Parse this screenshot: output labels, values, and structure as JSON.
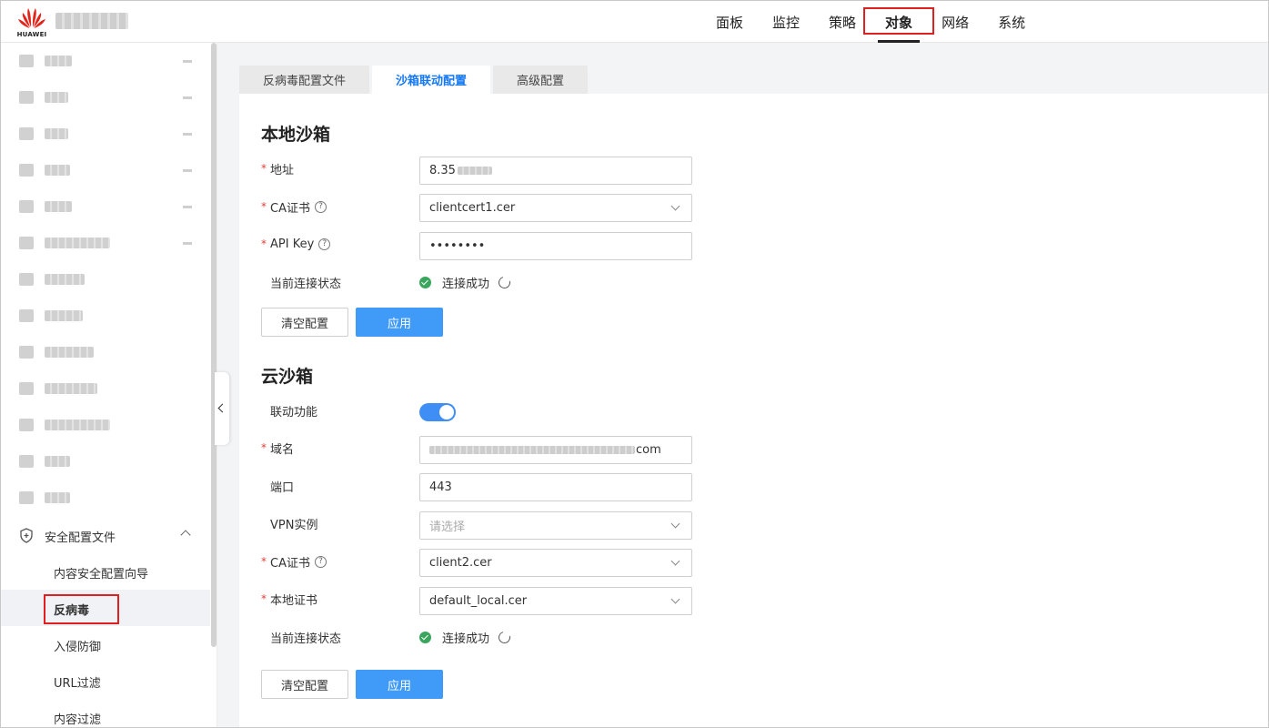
{
  "header": {
    "logo_text": "HUAWEI",
    "nav": [
      {
        "label": "面板"
      },
      {
        "label": "监控"
      },
      {
        "label": "策略"
      },
      {
        "label": "对象",
        "active": true
      },
      {
        "label": "网络"
      },
      {
        "label": "系统"
      }
    ]
  },
  "sidebar": {
    "group_label": "安全配置文件",
    "sub_items": [
      {
        "label": "内容安全配置向导"
      },
      {
        "label": "反病毒",
        "active": true
      },
      {
        "label": "入侵防御"
      },
      {
        "label": "URL过滤"
      },
      {
        "label": "内容过滤"
      }
    ]
  },
  "tabs": [
    {
      "label": "反病毒配置文件"
    },
    {
      "label": "沙箱联动配置",
      "active": true
    },
    {
      "label": "高级配置"
    }
  ],
  "local_sandbox": {
    "title": "本地沙箱",
    "address_label": "地址",
    "address_value": "8.35",
    "ca_cert_label": "CA证书",
    "ca_cert_value": "clientcert1.cer",
    "api_key_label": "API Key",
    "api_key_value": "••••••••",
    "status_label": "当前连接状态",
    "status_value": "连接成功",
    "clear_button": "清空配置",
    "apply_button": "应用"
  },
  "cloud_sandbox": {
    "title": "云沙箱",
    "link_label": "联动功能",
    "link_enabled": true,
    "domain_label": "域名",
    "domain_suffix": "com",
    "port_label": "端口",
    "port_value": "443",
    "vpn_label": "VPN实例",
    "vpn_placeholder": "请选择",
    "ca_cert_label": "CA证书",
    "ca_cert_value": "client2.cer",
    "local_cert_label": "本地证书",
    "local_cert_value": "default_local.cer",
    "status_label": "当前连接状态",
    "status_value": "连接成功",
    "clear_button": "清空配置",
    "apply_button": "应用"
  },
  "colors": {
    "primary": "#3f9bf7",
    "active_tab_text": "#1678f2",
    "highlight_box": "#e02020",
    "success": "#3aa55c",
    "required": "#e0403b"
  }
}
